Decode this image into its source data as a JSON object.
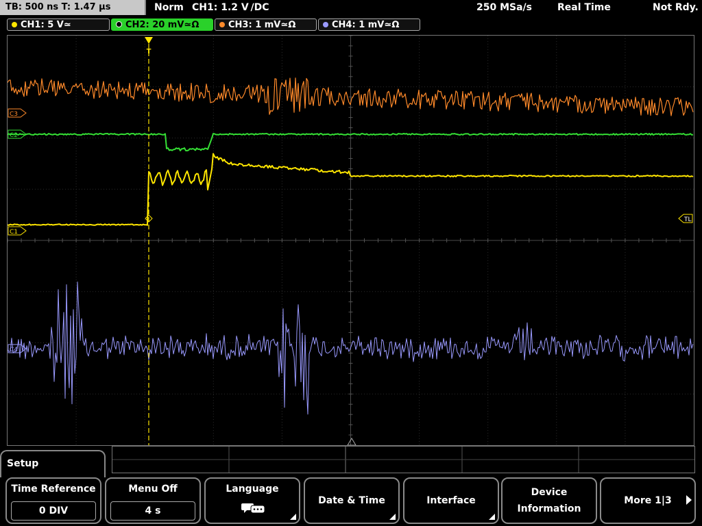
{
  "top": {
    "timebase": "TB: 500 ns   T: 1.47 µs",
    "mode": "Norm",
    "trigger": "CH1: 1.2 V ∕DC",
    "sample_rate": "250 MSa/s",
    "acq_mode": "Real Time",
    "state": "Not Rdy."
  },
  "channels": [
    {
      "label": "CH1: 5 V≃",
      "color": "#ffe600",
      "active": false
    },
    {
      "label": "CH2: 20 mV≃Ω",
      "color": "#35e035",
      "active": true
    },
    {
      "label": "CH3: 1 mV≃Ω",
      "color": "#ff8a2a",
      "active": false
    },
    {
      "label": "CH4: 1 mV≃Ω",
      "color": "#9a9aff",
      "active": false
    }
  ],
  "markers": {
    "c3": "C3",
    "c2": "C2",
    "c1": "C1",
    "c4": "C4",
    "trigger_level": "TL",
    "trigger_pos": "T"
  },
  "menu": {
    "title": "Setup",
    "keys": [
      {
        "title": "Time Reference",
        "value": "0 DIV"
      },
      {
        "title": "Menu Off",
        "value": "4 s"
      },
      {
        "title": "Language",
        "icon": "speech-bubbles-icon"
      },
      {
        "title": "Date & Time"
      },
      {
        "title": "Interface"
      },
      {
        "title_line1": "Device",
        "title_line2": "Information"
      },
      {
        "title": "More 1|3"
      }
    ]
  }
}
